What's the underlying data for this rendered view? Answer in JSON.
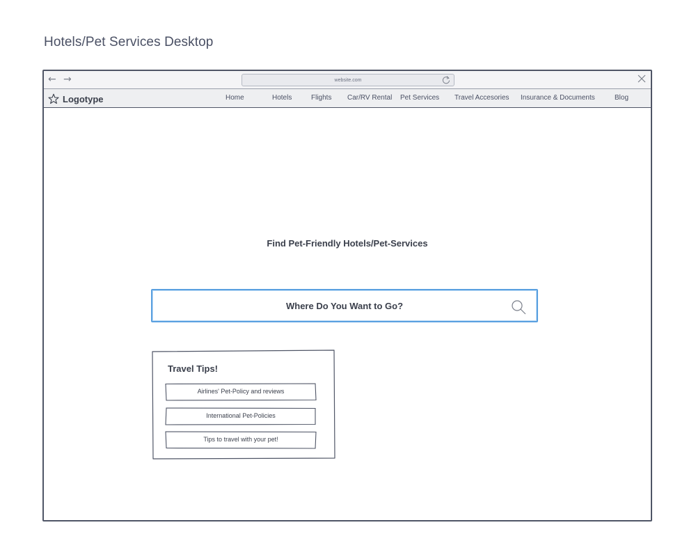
{
  "page": {
    "title": "Hotels/Pet Services Desktop"
  },
  "browser": {
    "url": "website.com",
    "back_icon": "arrow-left-icon",
    "forward_icon": "arrow-right-icon",
    "reload_icon": "reload-icon",
    "close_icon": "close-icon"
  },
  "site_nav": {
    "logo_icon": "star-icon",
    "logo_text": "Logotype",
    "links": [
      {
        "label": "Home"
      },
      {
        "label": "Hotels"
      },
      {
        "label": "Flights"
      },
      {
        "label": "Car/RV Rental"
      },
      {
        "label": "Pet Services"
      },
      {
        "label": "Travel Accesories"
      },
      {
        "label": "Insurance & Documents"
      },
      {
        "label": "Blog"
      }
    ]
  },
  "main": {
    "hero_title": "Find Pet-Friendly Hotels/Pet-Services",
    "search": {
      "placeholder": "Where Do You Want to Go?",
      "icon": "search-icon",
      "accent_color": "#5aa0e0"
    },
    "travel_tips": {
      "title": "Travel Tips!",
      "items": [
        {
          "label": "Airlines' Pet-Policy and reviews"
        },
        {
          "label": "International Pet-Policies"
        },
        {
          "label": "Tips to travel with your pet!"
        }
      ]
    }
  }
}
